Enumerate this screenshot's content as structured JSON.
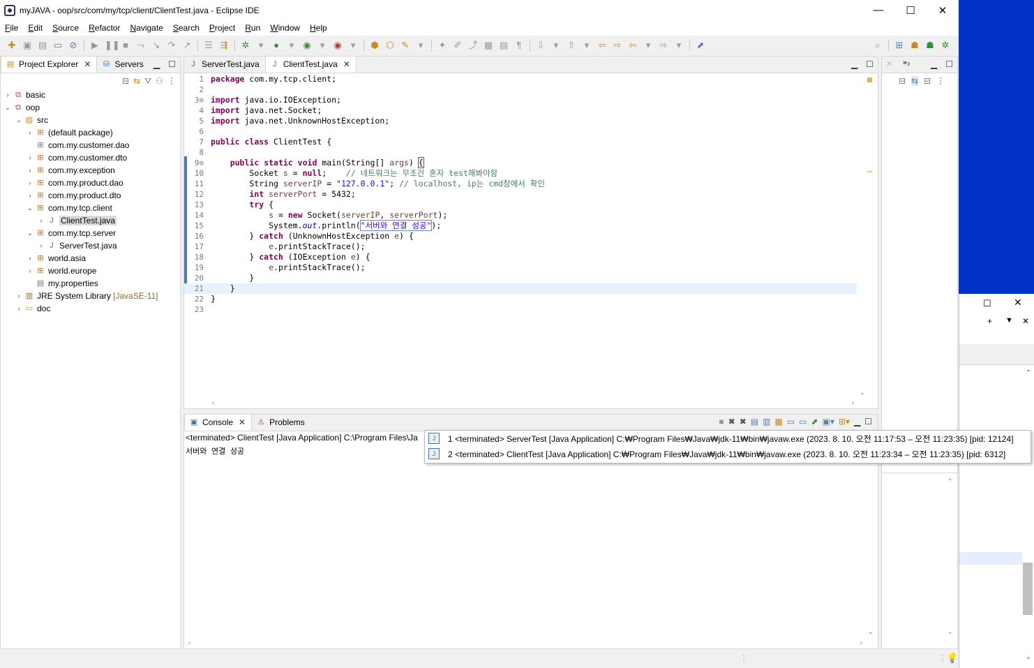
{
  "window": {
    "title": "myJAVA - oop/src/com/my/tcp/client/ClientTest.java - Eclipse IDE",
    "minimize": "—",
    "maximize": "☐",
    "close": "✕"
  },
  "menu": [
    "File",
    "Edit",
    "Source",
    "Refactor",
    "Navigate",
    "Search",
    "Project",
    "Run",
    "Window",
    "Help"
  ],
  "explorer": {
    "tabs": [
      {
        "label": "Project Explorer",
        "close": "✕"
      },
      {
        "label": "Servers"
      }
    ],
    "tree": [
      {
        "label": "basic"
      },
      {
        "label": "oop"
      },
      {
        "label": "src"
      },
      {
        "label": "(default package)"
      },
      {
        "label": "com.my.customer.dao"
      },
      {
        "label": "com.my.customer.dto"
      },
      {
        "label": "com.my.exception"
      },
      {
        "label": "com.my.product.dao"
      },
      {
        "label": "com.my.product.dto"
      },
      {
        "label": "com.my.tcp.client"
      },
      {
        "label": "ClientTest.java"
      },
      {
        "label": "com.my.tcp.server"
      },
      {
        "label": "ServerTest.java"
      },
      {
        "label": "world.asia"
      },
      {
        "label": "world.europe"
      },
      {
        "label": "my.properties"
      },
      {
        "label": "JRE System Library",
        "decoration": "[JavaSE-11]"
      },
      {
        "label": "doc"
      }
    ]
  },
  "editor": {
    "tabs": [
      {
        "label": "ServerTest.java"
      },
      {
        "label": "ClientTest.java",
        "close": "✕"
      }
    ],
    "line_numbers": [
      "1",
      "2",
      "3⊖",
      "4",
      "5",
      "6",
      "7",
      "8",
      "9⊖",
      "10",
      "11",
      "12",
      "13",
      "14",
      "15",
      "16",
      "17",
      "18",
      "19",
      "20",
      "21",
      "22",
      "23"
    ]
  },
  "console": {
    "tabs": [
      {
        "label": "Console",
        "close": "✕"
      },
      {
        "label": "Problems"
      }
    ],
    "header": "<terminated> ClientTest [Java Application] C:\\Program Files\\Ja",
    "output": "서버와 연결 성공"
  },
  "launch_popup": {
    "items": [
      {
        "text": "1 <terminated> ServerTest [Java Application] C:₩Program Files₩Java₩jdk-11₩bin₩javaw.exe  (2023. 8. 10. 오전 11:17:53 – 오전 11:23:35) [pid: 12124]"
      },
      {
        "text": "2 <terminated> ClientTest [Java Application] C:₩Program Files₩Java₩jdk-11₩bin₩javaw.exe  (2023. 8. 10. 오전 11:23:34 – 오전 11:23:35) [pid: 6312]"
      }
    ]
  },
  "colors": {
    "keyword": "#7f0055",
    "string": "#2a00ff",
    "comment": "#3f7f5f",
    "desktop": "#0032c8"
  }
}
